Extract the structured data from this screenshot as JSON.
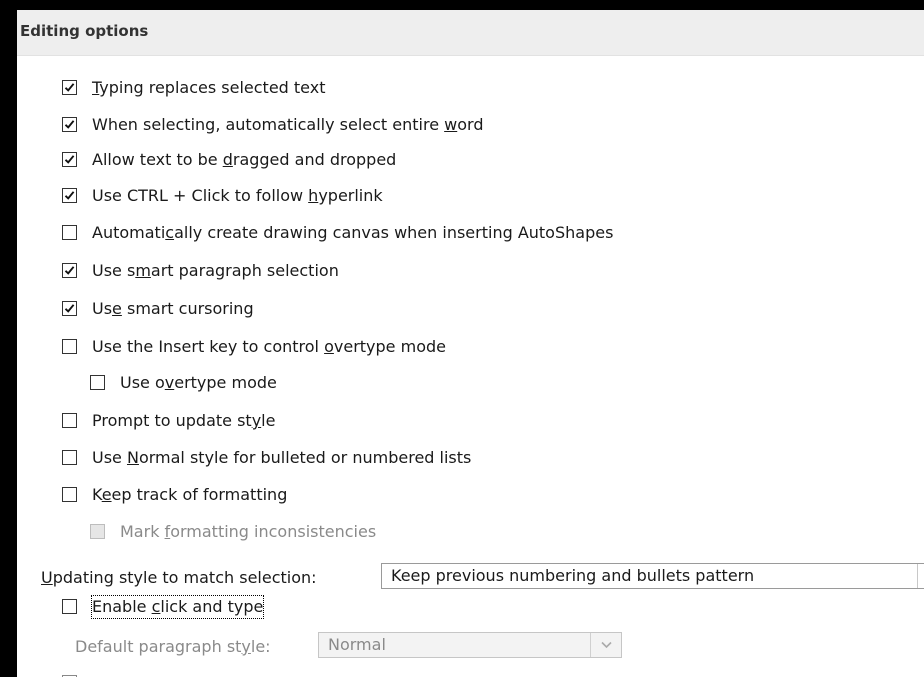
{
  "section": {
    "title": "Editing options"
  },
  "options": [
    {
      "pre": "",
      "key": "T",
      "post": "yping replaces selected text",
      "checked": true
    },
    {
      "pre": "When selecting, automatically select entire ",
      "key": "w",
      "post": "ord",
      "checked": true
    },
    {
      "pre": "Allow text to be ",
      "key": "d",
      "post": "ragged and dropped",
      "checked": true
    },
    {
      "pre": "Use CTRL + Click to follow ",
      "key": "h",
      "post": "yperlink",
      "checked": true
    },
    {
      "pre": "Automati",
      "key": "c",
      "post": "ally create drawing canvas when inserting AutoShapes",
      "checked": false
    },
    {
      "pre": "Use s",
      "key": "m",
      "post": "art paragraph selection",
      "checked": true
    },
    {
      "pre": "Us",
      "key": "e",
      "post": " smart cursoring",
      "checked": true
    },
    {
      "pre": "Use the Insert key to control ",
      "key": "o",
      "post": "vertype mode",
      "checked": false
    },
    {
      "pre": "Use o",
      "key": "v",
      "post": "ertype mode",
      "checked": false
    },
    {
      "pre": "Prompt to update st",
      "key": "y",
      "post": "le",
      "checked": false
    },
    {
      "pre": "Use ",
      "key": "N",
      "post": "ormal style for bulleted or numbered lists",
      "checked": false
    },
    {
      "pre": "K",
      "key": "e",
      "post": "ep track of formatting",
      "checked": false
    },
    {
      "pre": "Mark ",
      "key": "f",
      "post": "ormatting inconsistencies",
      "checked": false,
      "disabled": true
    }
  ],
  "updating_style": {
    "label_key": "U",
    "label_rest": "pdating style to match selection:",
    "value": "Keep previous numbering and bullets pattern"
  },
  "click_and_type": {
    "pre": "Enable ",
    "key": "c",
    "post": "lick and type",
    "checked": false
  },
  "default_paragraph_style": {
    "label_pre": "Default paragraph st",
    "label_key": "y",
    "label_post": "le:",
    "value": "Normal"
  },
  "icons": {
    "check": "checkmark-icon",
    "dropdown": "chevron-down-icon"
  },
  "colors": {
    "window_bg": "#000000",
    "panel_bg": "#ffffff",
    "header_bg": "#eeeeee",
    "disabled_text": "#8a8a8a"
  }
}
